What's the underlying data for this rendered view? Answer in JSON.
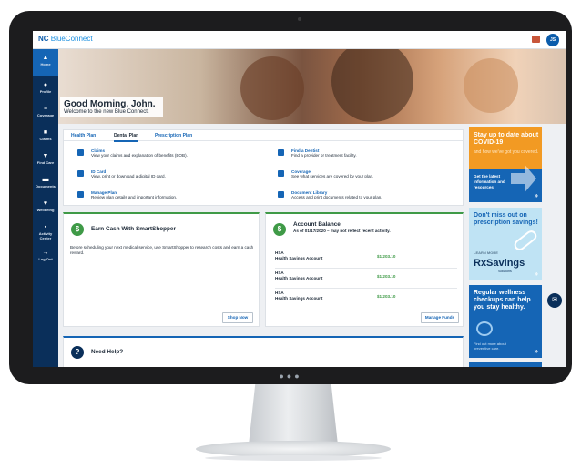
{
  "app": {
    "logo_text": "NC",
    "logo_brand": "BlueConnect",
    "user_initials": "JS"
  },
  "sidebar": {
    "items": [
      {
        "label": "Home",
        "icon": "home-icon"
      },
      {
        "label": "Profile",
        "icon": "profile-icon"
      },
      {
        "label": "Coverage",
        "icon": "coverage-icon"
      },
      {
        "label": "Claims",
        "icon": "claims-icon"
      },
      {
        "label": "Find Care",
        "icon": "find-care-icon"
      },
      {
        "label": "Documents",
        "icon": "documents-icon"
      },
      {
        "label": "Wellbeing",
        "icon": "wellbeing-icon"
      },
      {
        "label": "Activity Center",
        "icon": "activity-icon"
      },
      {
        "label": "Log Out",
        "icon": "logout-icon"
      }
    ]
  },
  "hero": {
    "greeting": "Good Morning, John.",
    "subtitle": "Welcome to the new Blue Connect."
  },
  "plans": {
    "tabs": [
      "Health Plan",
      "Dental Plan",
      "Prescription Plan"
    ],
    "active_tab": "Dental Plan",
    "items": [
      {
        "title": "Claims",
        "desc": "View your claims and explanation of benefits (EOB)."
      },
      {
        "title": "Find a Dentist",
        "desc": "Find a provider or treatment facility."
      },
      {
        "title": "ID Card",
        "desc": "View, print or download a digital ID card."
      },
      {
        "title": "Coverage",
        "desc": "See what services are covered by your plan."
      },
      {
        "title": "Manage Plan",
        "desc": "Review plan details and important information."
      },
      {
        "title": "Document Library",
        "desc": "Access and print documents related to your plan."
      }
    ]
  },
  "earn": {
    "title": "Earn Cash With SmartShopper",
    "body": "Before scheduling your next medical service, use SmartShopper to research costs and earn a cash reward.",
    "button": "Shop Now"
  },
  "account": {
    "title": "Account Balance",
    "subtitle": "As of 01/17/2020 – may not reflect recent activity.",
    "rows": [
      {
        "type": "HSA",
        "name": "Health Savings Account",
        "amount": "$1,203.10"
      },
      {
        "type": "HSA",
        "name": "Health Savings Account",
        "amount": "$1,203.10"
      },
      {
        "type": "HSA",
        "name": "Health Savings Account",
        "amount": "$1,203.10"
      }
    ],
    "button": "Manage Funds"
  },
  "help": {
    "title": "Need Help?"
  },
  "promos": {
    "covid": {
      "headline": "Stay up to date about COVID-19",
      "sub": "and how we've got you covered.",
      "cta": "Get the latest information and resources"
    },
    "rx": {
      "headline": "Don't miss out on prescription savings!",
      "learn": "LEARN MORE",
      "brand": "RxSavings",
      "brand_sub": "Solutions"
    },
    "wellness": {
      "headline": "Regular wellness checkups can help you stay healthy.",
      "sub": "Find out more about preventive care."
    }
  },
  "colors": {
    "primary": "#1565b5",
    "navy": "#0a2f5a",
    "green": "#3f9a47",
    "orange": "#f29a23"
  }
}
